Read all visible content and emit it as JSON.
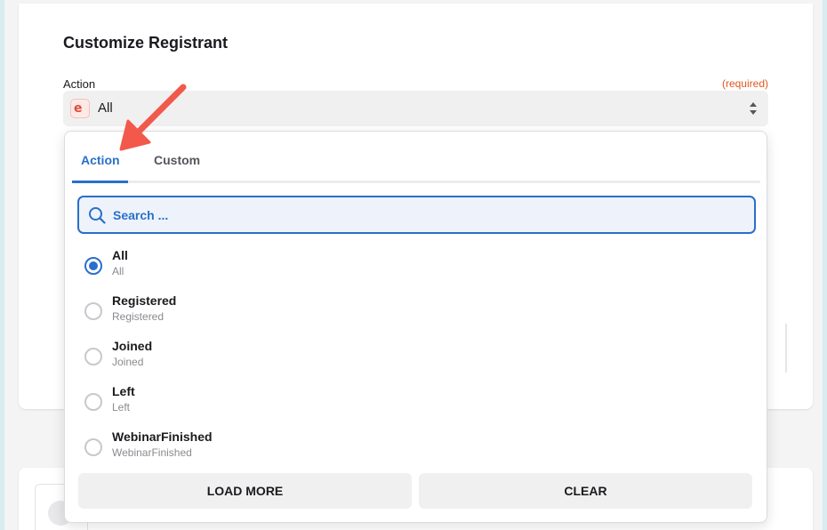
{
  "form": {
    "title": "Customize Registrant",
    "field_label": "Action",
    "required_text": "(required)",
    "selected_value": "All",
    "app_icon_letter": "e"
  },
  "dropdown": {
    "tabs": [
      {
        "label": "Action",
        "active": true
      },
      {
        "label": "Custom",
        "active": false
      }
    ],
    "search_placeholder": "Search ...",
    "options": [
      {
        "label": "All",
        "sublabel": "All",
        "checked": true
      },
      {
        "label": "Registered",
        "sublabel": "Registered",
        "checked": false
      },
      {
        "label": "Joined",
        "sublabel": "Joined",
        "checked": false
      },
      {
        "label": "Left",
        "sublabel": "Left",
        "checked": false
      },
      {
        "label": "WebinarFinished",
        "sublabel": "WebinarFinished",
        "checked": false
      }
    ],
    "load_more_label": "LOAD MORE",
    "clear_label": "CLEAR"
  },
  "colors": {
    "accent": "#2a6fc9",
    "required": "#e0571e",
    "annotation_arrow": "#f2594b"
  },
  "icons": [
    "search-icon",
    "select-arrows-icon",
    "app-logo-icon",
    "annotation-arrow-icon"
  ]
}
